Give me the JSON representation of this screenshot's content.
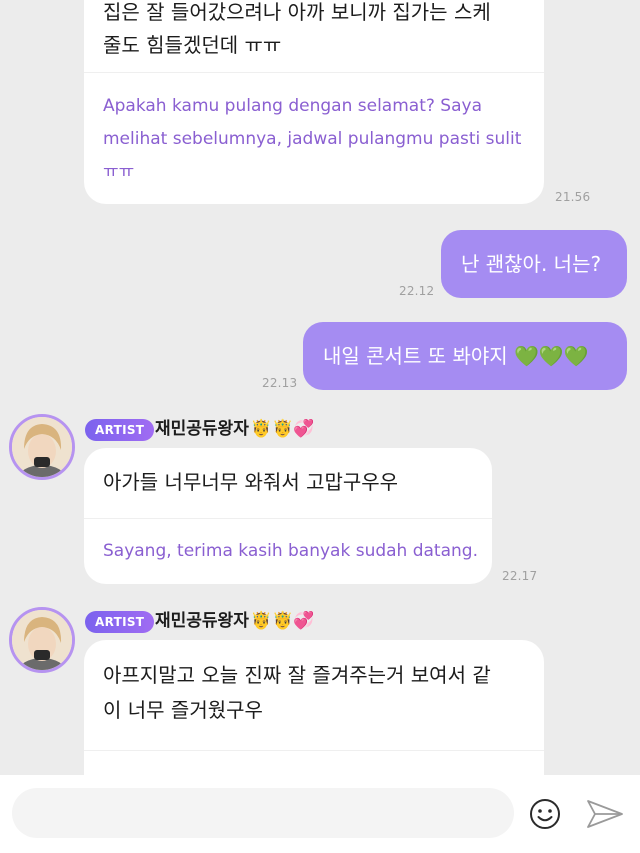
{
  "messages": {
    "m1": {
      "korean_line1": "집은 잘 들어갔으려나 아까 보니까 집가는 스케",
      "korean_line2": "줄도 힘들겠던데 ㅠㅠ",
      "translation_line1": "Apakah kamu pulang dengan selamat? Saya",
      "translation_line2": "melihat sebelumnya, jadwal pulangmu pasti sulit",
      "translation_line3": "ㅠㅠ",
      "time": "21.56"
    },
    "m2": {
      "text": "난 괜찮아. 너는?",
      "time": "22.12"
    },
    "m3": {
      "text": "내일 콘서트 또 봐야지 ",
      "hearts": "💚💚💚",
      "time": "22.13"
    },
    "m4": {
      "badge": "ARTIST",
      "sender": "재민공듀왕자",
      "sender_emoji": "🤴🤴💞",
      "korean_line1": "아가들 너무너무 와줘서 고맙구우우",
      "translation_line1": "Sayang, terima kasih banyak sudah datang.",
      "time": "22.17"
    },
    "m5": {
      "badge": "ARTIST",
      "sender": "재민공듀왕자",
      "sender_emoji": "🤴🤴💞",
      "korean_line1": "아프지말고 오늘 진짜 잘 즐겨주는거 보여서 같",
      "korean_line2": "이 너무 즐거웠구우"
    }
  },
  "composer": {
    "placeholder": "",
    "emoji_icon": "smiley-icon",
    "send_icon": "paper-plane-icon"
  },
  "colors": {
    "background": "#ececec",
    "outgoing_bubble": "#a58cf2",
    "translation_text": "#8a5fd1",
    "artist_badge": "#7b62ee",
    "heart": "#2ec86f"
  }
}
